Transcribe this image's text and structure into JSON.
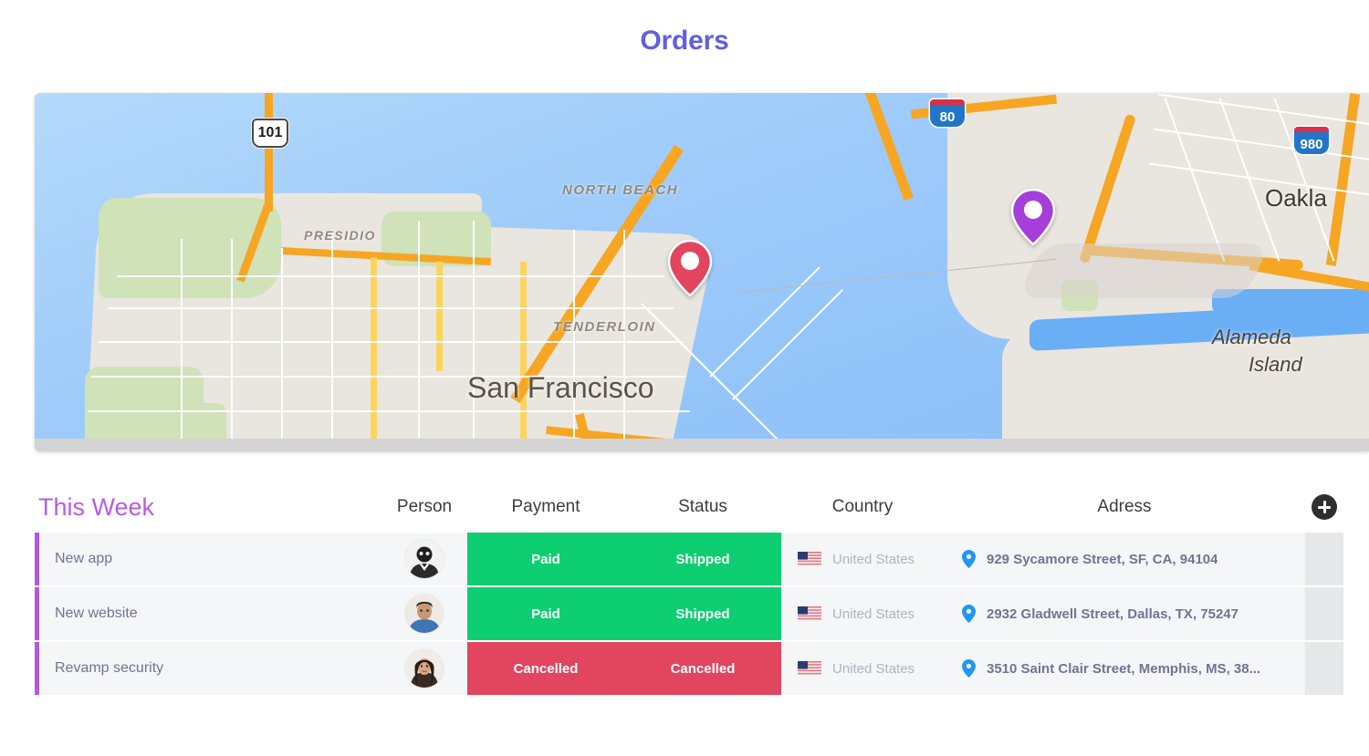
{
  "header": {
    "title": "Orders"
  },
  "map": {
    "labels": [
      {
        "text": "PRESIDIO",
        "type": "district"
      },
      {
        "text": "NORTH BEACH",
        "type": "district"
      },
      {
        "text": "TENDERLOIN",
        "type": "district"
      },
      {
        "text": "San Francisco",
        "type": "city"
      },
      {
        "text": "Oakla",
        "type": "city-clipped"
      },
      {
        "text": "Alameda",
        "type": "place"
      },
      {
        "text": "Island",
        "type": "place"
      }
    ],
    "shields": [
      {
        "label": "101",
        "kind": "us-route"
      },
      {
        "label": "80",
        "kind": "interstate"
      },
      {
        "label": "980",
        "kind": "interstate"
      }
    ],
    "markers": [
      {
        "name": "san-francisco-marker",
        "color": "#e2455e"
      },
      {
        "name": "oakland-marker",
        "color": "#a63fd9"
      }
    ]
  },
  "table": {
    "headers": {
      "week": "This Week",
      "person": "Person",
      "payment": "Payment",
      "status": "Status",
      "country": "Country",
      "adress": "Adress",
      "add": "+"
    },
    "accent_color": "#b159e2",
    "status_colors": {
      "positive": "#0ece72",
      "negative": "#e2455e"
    },
    "rows": [
      {
        "task": "New app",
        "person": "avatar-1",
        "payment": "Paid",
        "payment_state": "positive",
        "status": "Shipped",
        "status_state": "positive",
        "country": "United States",
        "adress": "929 Sycamore Street, SF, CA, 94104"
      },
      {
        "task": "New website",
        "person": "avatar-2",
        "payment": "Paid",
        "payment_state": "positive",
        "status": "Shipped",
        "status_state": "positive",
        "country": "United States",
        "adress": "2932 Gladwell Street, Dallas, TX, 75247"
      },
      {
        "task": "Revamp security",
        "person": "avatar-3",
        "payment": "Cancelled",
        "payment_state": "negative",
        "status": "Cancelled",
        "status_state": "negative",
        "country": "United States",
        "adress": "3510 Saint Clair Street, Memphis, MS, 38..."
      }
    ]
  }
}
